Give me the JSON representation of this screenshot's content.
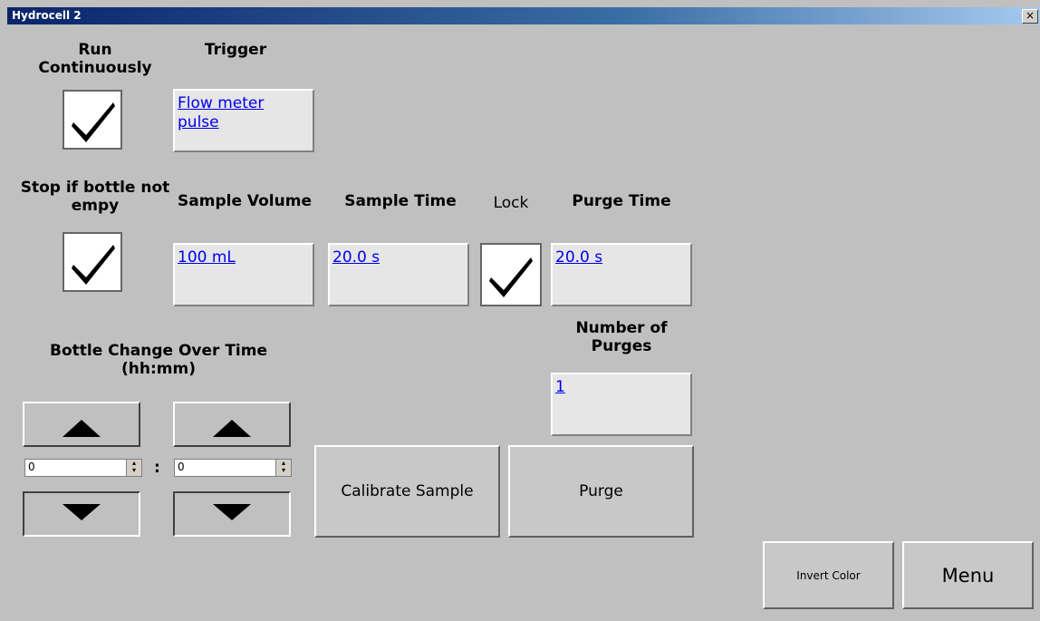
{
  "window": {
    "title": "Hydrocell 2",
    "close_label": "×"
  },
  "run_continuously": {
    "label": "Run Continuously",
    "checked": true
  },
  "trigger": {
    "label": "Trigger",
    "value": "Flow meter pulse"
  },
  "stop_if_not_empty": {
    "label": "Stop if bottle not empy",
    "checked": true
  },
  "sample_volume": {
    "label": "Sample Volume",
    "value": "100 mL"
  },
  "sample_time": {
    "label": "Sample Time",
    "value": "20.0 s"
  },
  "lock": {
    "label": "Lock",
    "checked": true
  },
  "purge_time": {
    "label": "Purge Time",
    "value": "20.0 s"
  },
  "number_of_purges": {
    "label": "Number of Purges",
    "value": "1"
  },
  "bottle_change": {
    "label": "Bottle Change Over Time (hh:mm)",
    "hours": "0",
    "minutes": "0",
    "separator": ":"
  },
  "buttons": {
    "calibrate": "Calibrate Sample",
    "purge": "Purge",
    "invert": "Invert Color",
    "menu": "Menu"
  }
}
